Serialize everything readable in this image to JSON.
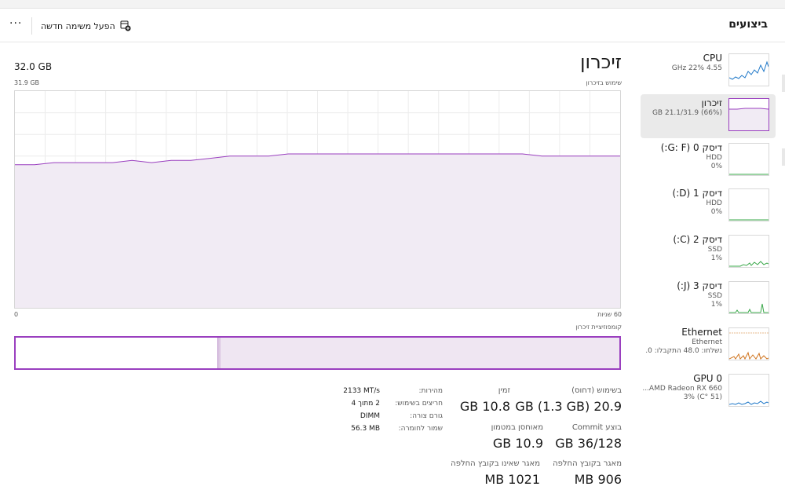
{
  "header": {
    "title": "ביצועים",
    "new_task_label": "הפעל משימה חדשה",
    "more_label": "···"
  },
  "sidebar": {
    "items": [
      {
        "title": "CPU",
        "sub1": "4.55 GHz  22%",
        "sub2": "",
        "color": "#1f78c8"
      },
      {
        "title": "זיכרון",
        "sub1": "(66%) 21.1/31.9 GB",
        "sub2": "",
        "color": "#9a3fbf"
      },
      {
        "title": "דיסק 0 (G: F:)",
        "sub1": "HDD",
        "sub2": "0%",
        "color": "#3aa84a"
      },
      {
        "title": "דיסק 1 (D:)",
        "sub1": "HDD",
        "sub2": "0%",
        "color": "#3aa84a"
      },
      {
        "title": "דיסק 2 (C:)",
        "sub1": "SSD",
        "sub2": "1%",
        "color": "#3aa84a"
      },
      {
        "title": "דיסק 3 (J:)",
        "sub1": "SSD",
        "sub2": "1%",
        "color": "#3aa84a"
      },
      {
        "title": "Ethernet",
        "sub1": "Ethernet",
        "sub2": "נשלחו: 48.0 התקבלו: 0.",
        "color": "#d0741f"
      },
      {
        "title": "GPU 0",
        "sub1": "AMD Radeon RX 660...",
        "sub2": "(51 °C) 3%",
        "color": "#1f78c8"
      }
    ]
  },
  "main": {
    "title": "זיכרון",
    "subtitle": "שימוש בזיכרון",
    "total_capacity": "32.0 GB",
    "scale_max": "31.9 GB",
    "axis_time": "60 שניות",
    "axis_zero": "0",
    "composition_label": "קומפוזיציית זיכרון",
    "graph_color": "#9a3fbf",
    "graph_fill": "#f1ebf4",
    "usage_percent": [
      66,
      66,
      67,
      67,
      67,
      67,
      68,
      67,
      68,
      68,
      69,
      70,
      70,
      70,
      71,
      71,
      71,
      71,
      71,
      71,
      71,
      71,
      71,
      71,
      71,
      71,
      71,
      70,
      70,
      70,
      70,
      70
    ],
    "composition": {
      "in_use_fraction": 0.66,
      "modified_fraction": 0.005
    }
  },
  "stats": {
    "in_use_label": "בשימוש (דחוס)",
    "in_use_value": "20.9 GB  (1.3 GB)",
    "available_label": "זמין",
    "available_value": "10.8 GB",
    "committed_label": "בוצע Commit",
    "committed_value": "36/128 GB",
    "cached_label": "מאוחסן במטמון",
    "cached_value": "10.9 GB",
    "paged_label": "מאגר בקובץ החלפה",
    "paged_value": "906 MB",
    "nonpaged_label": "מאגר שאינו בקובץ החלפה",
    "nonpaged_value": "1021 MB"
  },
  "details": {
    "speed_label": "מהירות:",
    "speed_value": "2133 MT/s",
    "slots_label": "חריצים בשימוש:",
    "slots_value": "2 מתוך 4",
    "form_label": "גורם צורה:",
    "form_value": "DIMM",
    "reserved_label": "שמור לחומרה:",
    "reserved_value": "56.3 MB"
  }
}
